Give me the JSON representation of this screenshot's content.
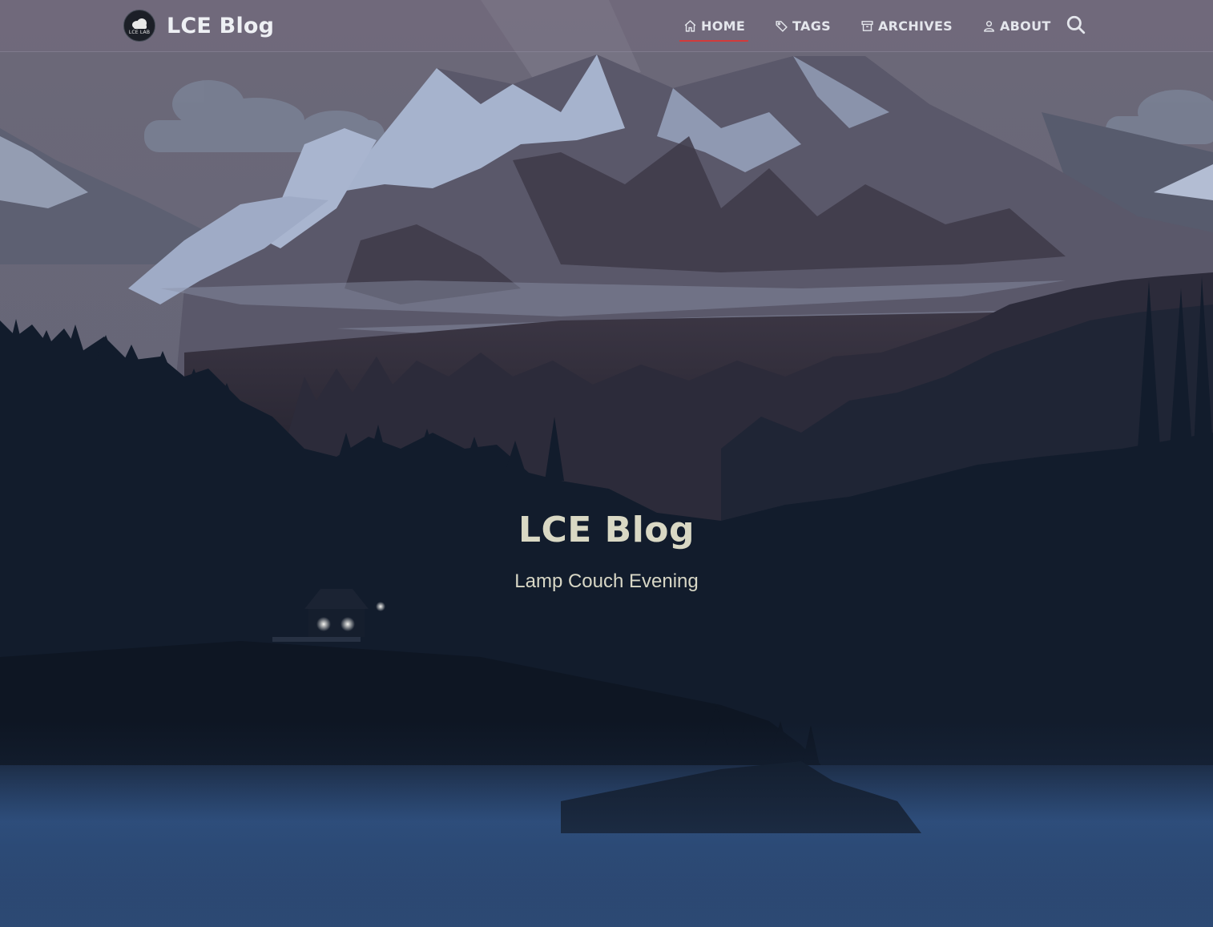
{
  "navbar": {
    "brand_title": "LCE Blog",
    "logo_text": "LCE LAB",
    "items": [
      {
        "label": "HOME",
        "icon": "home-icon",
        "active": true
      },
      {
        "label": "TAGS",
        "icon": "tag-icon",
        "active": false
      },
      {
        "label": "ARCHIVES",
        "icon": "archive-icon",
        "active": false
      },
      {
        "label": "ABOUT",
        "icon": "user-icon",
        "active": false
      }
    ],
    "search_icon": "search-icon"
  },
  "hero": {
    "title": "LCE Blog",
    "subtitle": "Lamp Couch Evening"
  },
  "colors": {
    "accent": "#d33a3a",
    "nav_text": "#e4e6ec",
    "hero_text": "#d9d8c4",
    "water": "#2a4a78"
  }
}
